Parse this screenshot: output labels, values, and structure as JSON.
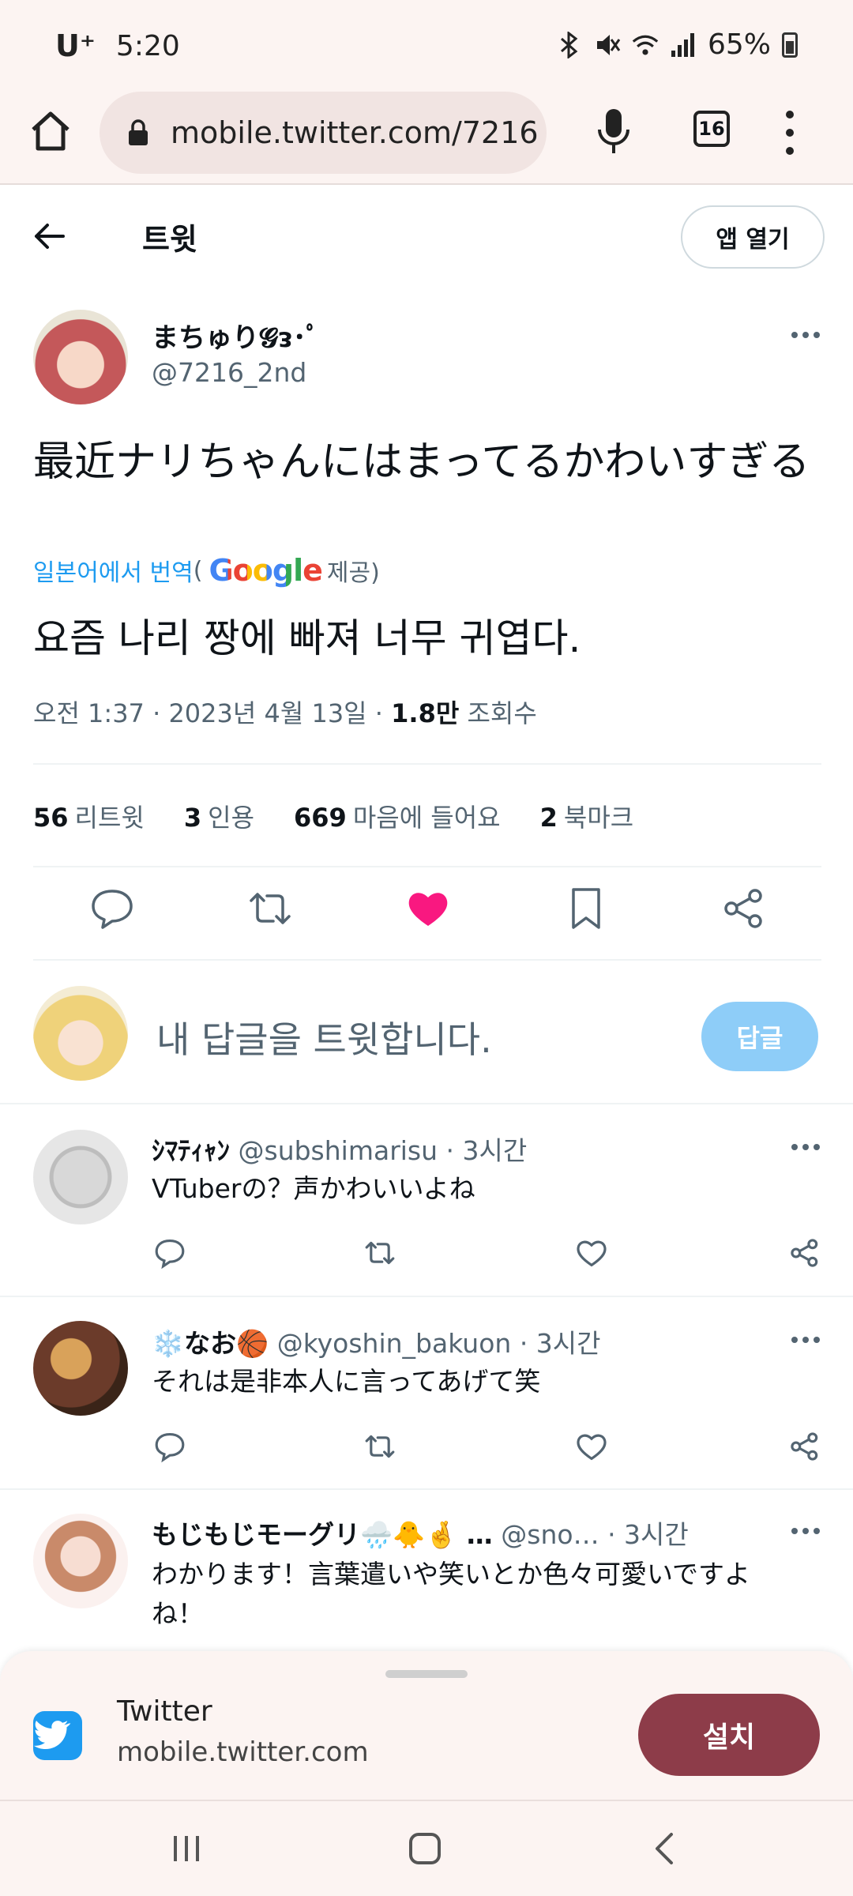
{
  "status_bar": {
    "carrier": "U⁺",
    "time": "5:20",
    "battery": "65%"
  },
  "browser": {
    "url": "mobile.twitter.com/7216",
    "tab_count": "16"
  },
  "header": {
    "title": "트윗",
    "open_app_label": "앱 열기"
  },
  "tweet": {
    "author_name": "まちゅり𝓖ᴈ･ﾟ",
    "author_handle": "@7216_2nd",
    "text": "最近ナリちゃんにはまってるかわいすぎる",
    "translate_link": "일본어에서 번역",
    "translate_open_paren": "(",
    "google_brand": "Google",
    "translate_provider_suffix": "제공)",
    "translated_text": "요즘 나리 짱에 빠져 너무 귀엽다.",
    "time": "오전 1:37",
    "date": "2023년 4월 13일",
    "views_count": "1.8만",
    "views_label": "조회수",
    "stats": {
      "retweets_count": "56",
      "retweets_label": "리트윗",
      "quotes_count": "3",
      "quotes_label": "인용",
      "likes_count": "669",
      "likes_label": "마음에 들어요",
      "bookmarks_count": "2",
      "bookmarks_label": "북마크"
    },
    "liked": true
  },
  "composer": {
    "placeholder": "내 답글을 트윗합니다.",
    "reply_button": "답글"
  },
  "replies": [
    {
      "name": "ｼﾏﾃｨｬﾝ",
      "handle": "@subshimarisu",
      "time": "· 3시간",
      "text": "VTuberの？声かわいいよね"
    },
    {
      "name": "❄️なお🏀",
      "handle": "@kyoshin_bakuon",
      "time": "· 3시간",
      "text": "それは是非本人に言ってあげて笑"
    },
    {
      "name": "もじもじモーグリ🌧️🐥🤞 …",
      "handle": "@sno…",
      "time": "· 3시간",
      "text": "わかります！言葉遣いや笑いとか色々可愛いですよね！"
    }
  ],
  "install_banner": {
    "app_name": "Twitter",
    "app_url": "mobile.twitter.com",
    "install_label": "설치"
  },
  "colors": {
    "twitter_blue": "#1d9bf0",
    "like_pink": "#f91880",
    "install_button": "#8d3c49",
    "reply_button_disabled": "#8ecdf8"
  }
}
